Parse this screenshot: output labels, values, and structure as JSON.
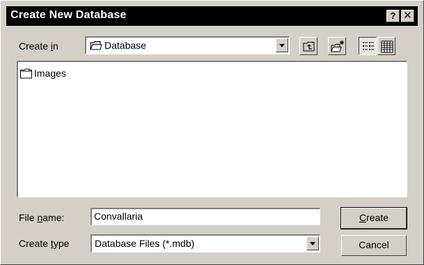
{
  "window": {
    "title": "Create New Database",
    "help_glyph": "?",
    "close_glyph": "✕"
  },
  "location": {
    "label_pre": "Create ",
    "label_key": "i",
    "label_post": "n",
    "current": "Database",
    "folder_icon": "folder-open-icon"
  },
  "toolbar": {
    "up_folder_icon": "up-one-level-icon",
    "new_folder_icon": "create-new-folder-icon",
    "list_view_icon": "list-view-icon",
    "details_view_icon": "details-view-icon"
  },
  "files": {
    "items": [
      {
        "name": "Images",
        "icon": "folder-icon"
      }
    ]
  },
  "filename": {
    "label_pre": "File ",
    "label_key": "n",
    "label_post": "ame:",
    "value": "Convallaria"
  },
  "filetype": {
    "label_pre": "Create ",
    "label_key": "t",
    "label_post": "ype",
    "value": "Database Files (*.mdb)"
  },
  "buttons": {
    "create_pre": "",
    "create_key": "C",
    "create_post": "reate",
    "cancel": "Cancel"
  }
}
